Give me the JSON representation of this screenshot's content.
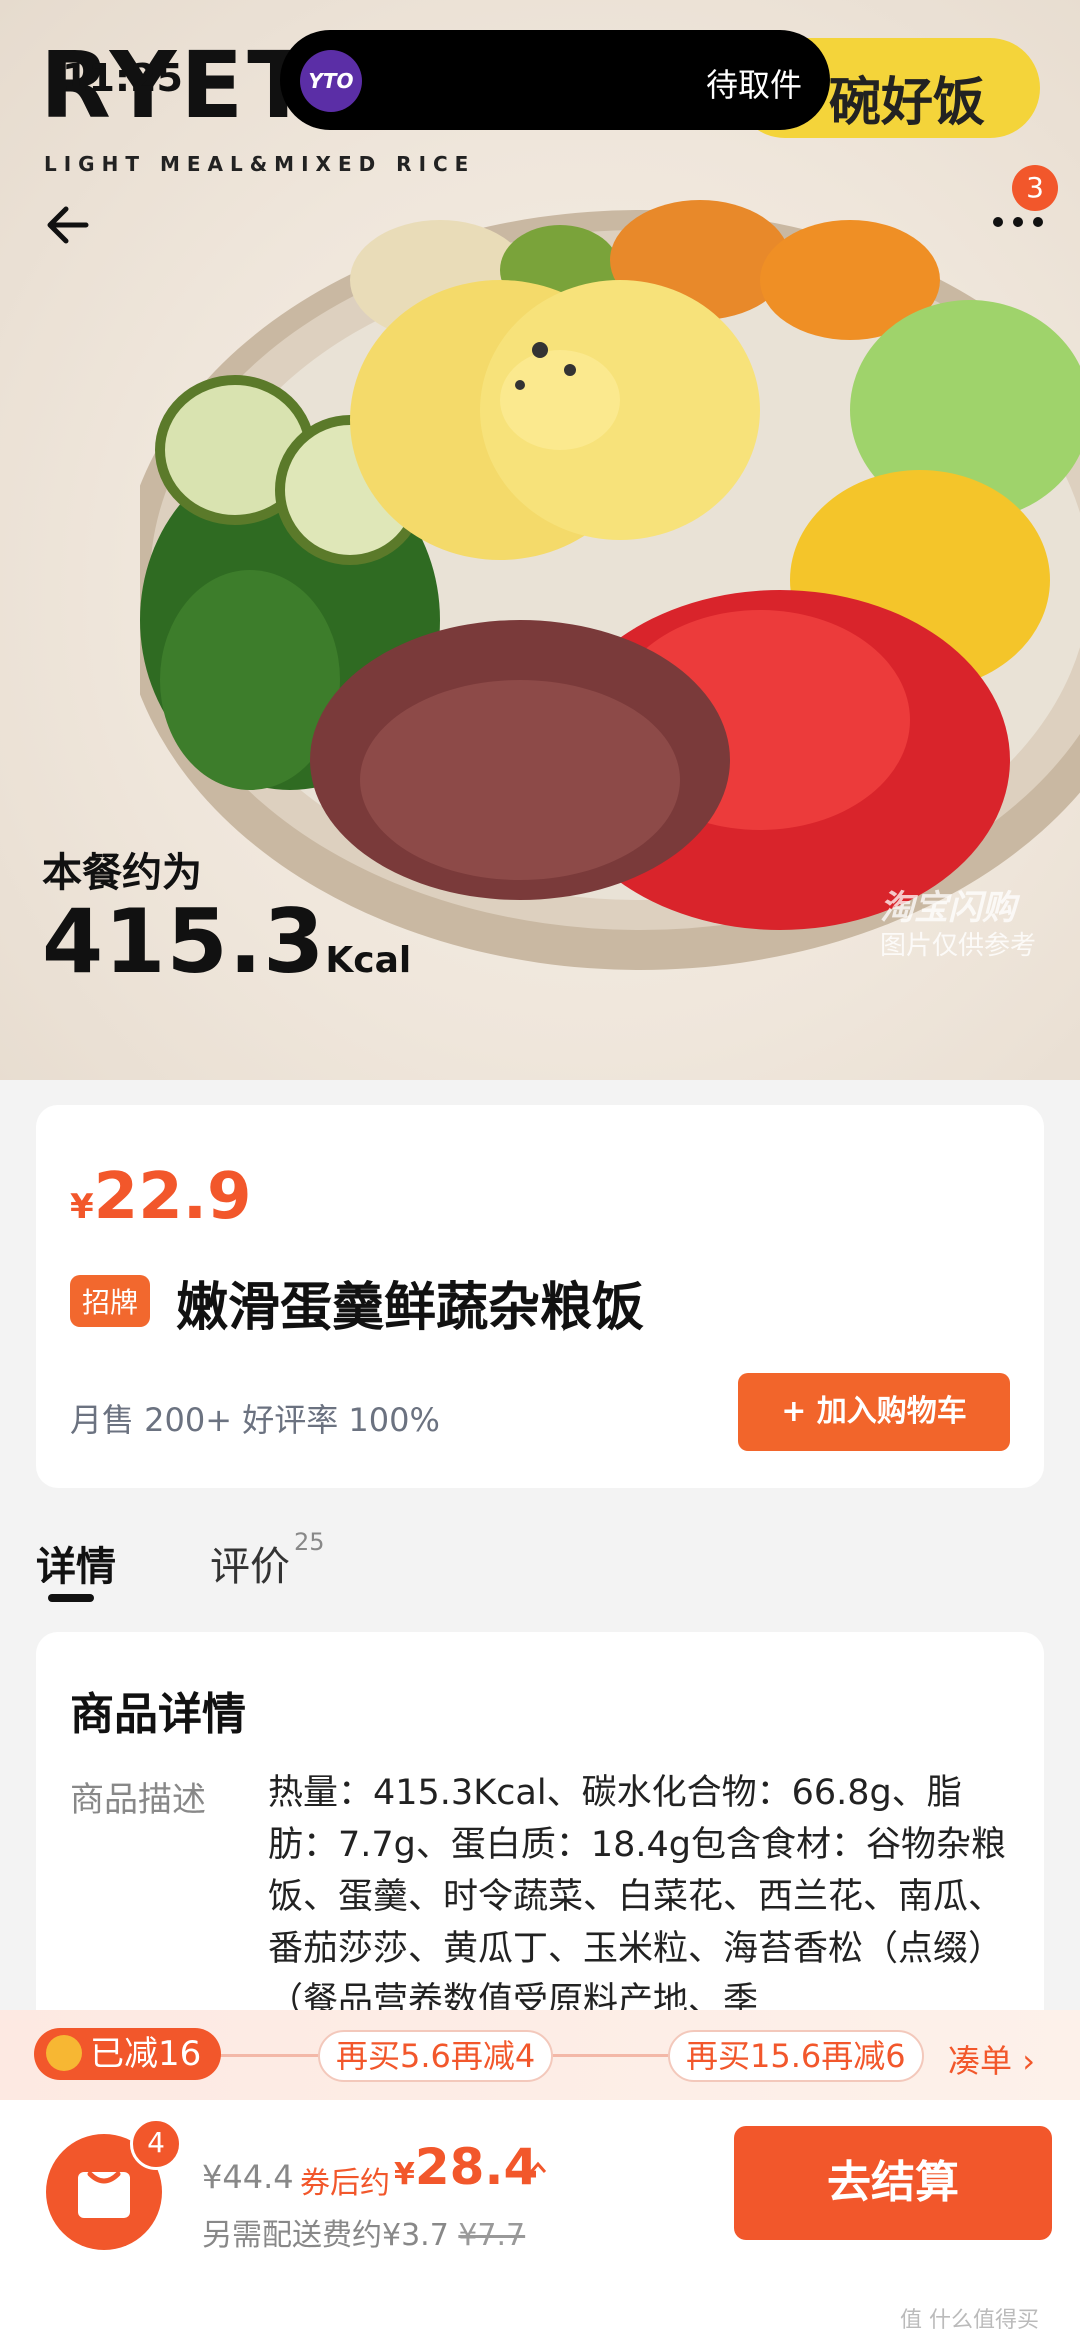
{
  "status": {
    "time": "11:25",
    "live_activity_logo": "YTO",
    "live_activity_text": "待取件"
  },
  "hero": {
    "brand": "RYETOKEN",
    "brand_sub": "LIGHT MEAL&MIXED RICE",
    "badge_text": "碗好饭",
    "kcal_label": "本餐约为",
    "kcal_value": "415.3",
    "kcal_unit": "Kcal",
    "watermark_title": "淘宝闪购",
    "watermark_note": "图片仅供参考",
    "more_badge": "3"
  },
  "product": {
    "currency": "¥",
    "price": "22.9",
    "tag": "招牌",
    "title": "嫩滑蛋羹鲜蔬杂粮饭",
    "stats": "月售 200+ 好评率 100%",
    "add_to_cart": "+ 加入购物车"
  },
  "tabs": [
    {
      "label": "详情",
      "count": ""
    },
    {
      "label": "评价",
      "count": "25"
    }
  ],
  "details": {
    "heading": "商品详情",
    "desc_label": "商品描述",
    "desc_text": "热量：415.3Kcal、碳水化合物：66.8g、脂肪：7.7g、蛋白质：18.4g包含食材：谷物杂粮饭、蛋羹、时令蔬菜、白菜花、西兰花、南瓜、番茄莎莎、黄瓜丁、玉米粒、海苔香松（点缀）（餐品营养数值受原料产地、季"
  },
  "promo": {
    "applied": "已减16",
    "step1": "再买5.6再减4",
    "step2": "再买15.6再减6",
    "cta": "凑单"
  },
  "cart": {
    "count": "4",
    "original": "¥44.4",
    "coupon_label": "券后约",
    "final_currency": "¥",
    "final": "28.4",
    "delivery_label": "另需配送费约¥3.7",
    "delivery_old": "¥7.7",
    "checkout": "去结算"
  },
  "corner_watermark": "值 什么值得买",
  "colors": {
    "accent": "#f2572b",
    "badge_yellow": "#f4d43a"
  }
}
